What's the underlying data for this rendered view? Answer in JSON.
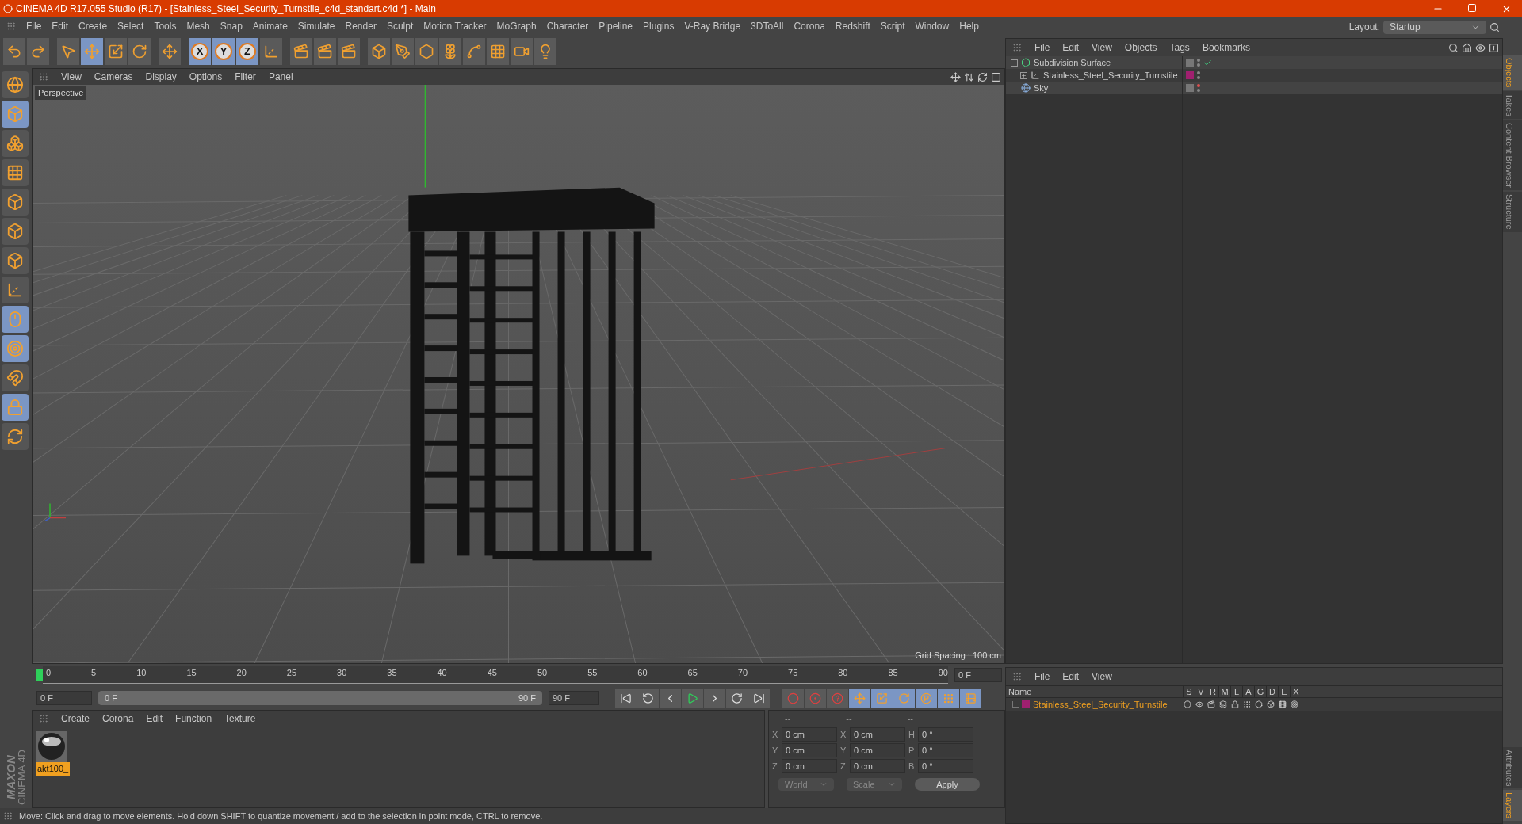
{
  "window": {
    "title": "CINEMA 4D R17.055 Studio (R17) - [Stainless_Steel_Security_Turnstile_c4d_standart.c4d *] - Main"
  },
  "menu": [
    "File",
    "Edit",
    "Create",
    "Select",
    "Tools",
    "Mesh",
    "Snap",
    "Animate",
    "Simulate",
    "Render",
    "Sculpt",
    "Motion Tracker",
    "MoGraph",
    "Character",
    "Pipeline",
    "Plugins",
    "V-Ray Bridge",
    "3DToAll",
    "Corona",
    "Redshift",
    "Script",
    "Window",
    "Help"
  ],
  "layout": {
    "label": "Layout:",
    "value": "Startup"
  },
  "toolbar": [
    {
      "kind": "icon",
      "on": false
    },
    {
      "kind": "icon",
      "on": false
    },
    {
      "kind": "sep"
    },
    {
      "kind": "icon",
      "on": false
    },
    {
      "kind": "icon",
      "on": true
    },
    {
      "kind": "icon",
      "on": false
    },
    {
      "kind": "icon",
      "on": false
    },
    {
      "kind": "sep"
    },
    {
      "kind": "icon",
      "on": false
    },
    {
      "kind": "sep"
    },
    {
      "kind": "axis",
      "label": "X",
      "on": true
    },
    {
      "kind": "axis",
      "label": "Y",
      "on": true
    },
    {
      "kind": "axis",
      "label": "Z",
      "on": true
    },
    {
      "kind": "icon",
      "on": false
    },
    {
      "kind": "sep"
    },
    {
      "kind": "icon",
      "on": false
    },
    {
      "kind": "icon",
      "on": false
    },
    {
      "kind": "icon",
      "on": false
    },
    {
      "kind": "sep"
    },
    {
      "kind": "icon",
      "on": false
    },
    {
      "kind": "icon",
      "on": false
    },
    {
      "kind": "icon",
      "on": false
    },
    {
      "kind": "icon",
      "on": false
    },
    {
      "kind": "icon",
      "on": false
    },
    {
      "kind": "icon",
      "on": false
    },
    {
      "kind": "icon",
      "on": false
    },
    {
      "kind": "icon",
      "on": false
    }
  ],
  "left_tools": [
    {
      "on": false
    },
    {
      "on": true
    },
    {
      "on": false
    },
    {
      "on": false
    },
    {
      "on": false
    },
    {
      "on": false
    },
    {
      "on": false
    },
    {
      "on": false
    },
    {
      "on": true
    },
    {
      "on": true
    },
    {
      "on": false
    },
    {
      "on": true
    },
    {
      "on": false
    }
  ],
  "viewport": {
    "menu": [
      "View",
      "Cameras",
      "Display",
      "Options",
      "Filter",
      "Panel"
    ],
    "label": "Perspective",
    "grid_spacing": "Grid Spacing : 100 cm"
  },
  "timeline": {
    "ticks": [
      "0",
      "5",
      "10",
      "15",
      "20",
      "25",
      "30",
      "35",
      "40",
      "45",
      "50",
      "55",
      "60",
      "65",
      "70",
      "75",
      "80",
      "85",
      "90"
    ],
    "current_frame": "0 F",
    "start": "0 F",
    "range": {
      "start": "0 F",
      "end": "90 F",
      "level": 1
    },
    "end": "90 F",
    "key_tools": [
      {
        "on": false
      },
      {
        "on": false
      },
      {
        "on": false
      },
      {
        "on": true
      },
      {
        "on": true
      },
      {
        "on": true
      },
      {
        "on": true
      },
      {
        "on": true
      },
      {
        "on": true
      }
    ]
  },
  "materials": {
    "menu": [
      "Create",
      "Corona",
      "Edit",
      "Function",
      "Texture"
    ],
    "items": [
      {
        "name": "akt100_",
        "selected": true
      }
    ]
  },
  "coordinates": {
    "headers": [
      "--",
      "--",
      "--"
    ],
    "rows": [
      {
        "axis": "X",
        "position": "0 cm",
        "size_axis": "X",
        "size": "0 cm",
        "rot_axis": "H",
        "rotation": "0 °"
      },
      {
        "axis": "Y",
        "position": "0 cm",
        "size_axis": "Y",
        "size": "0 cm",
        "rot_axis": "P",
        "rotation": "0 °"
      },
      {
        "axis": "Z",
        "position": "0 cm",
        "size_axis": "Z",
        "size": "0 cm",
        "rot_axis": "B",
        "rotation": "0 °"
      }
    ],
    "dropdowns": [
      "World",
      "Scale"
    ],
    "apply": "Apply"
  },
  "logo": {
    "brand": "MAXON",
    "product": "CINEMA 4D"
  },
  "status_bar": "Move: Click and drag to move elements. Hold down SHIFT to quantize movement / add to the selection in point mode, CTRL to remove.",
  "objects": {
    "menu": [
      "File",
      "Edit",
      "View",
      "Objects",
      "Tags",
      "Bookmarks"
    ],
    "tree": [
      {
        "name": "Subdivision Surface",
        "kind": "subdivision",
        "expanded": true,
        "enabled": true,
        "visible_in_editor": true,
        "children": [
          {
            "name": "Stainless_Steel_Security_Turnstile",
            "kind": "null",
            "expanded": false,
            "color": "#a0206f",
            "visible_in_editor": true
          }
        ]
      },
      {
        "name": "Sky",
        "kind": "sky",
        "visible_in_editor": false
      }
    ]
  },
  "side_tabs_top": [
    {
      "label": "Objects",
      "selected": true
    },
    {
      "label": "Takes",
      "selected": false
    },
    {
      "label": "Content Browser",
      "selected": false
    },
    {
      "label": "Structure",
      "selected": false
    }
  ],
  "side_tabs_bottom": [
    {
      "label": "Attributes",
      "selected": false
    },
    {
      "label": "Layers",
      "selected": true
    }
  ],
  "layers": {
    "menu": [
      "File",
      "Edit",
      "View"
    ],
    "columns": [
      "Name",
      "S",
      "V",
      "R",
      "M",
      "L",
      "A",
      "G",
      "D",
      "E",
      "X"
    ],
    "rows": [
      {
        "name": "Stainless_Steel_Security_Turnstile",
        "color": "#a0206f"
      }
    ]
  }
}
